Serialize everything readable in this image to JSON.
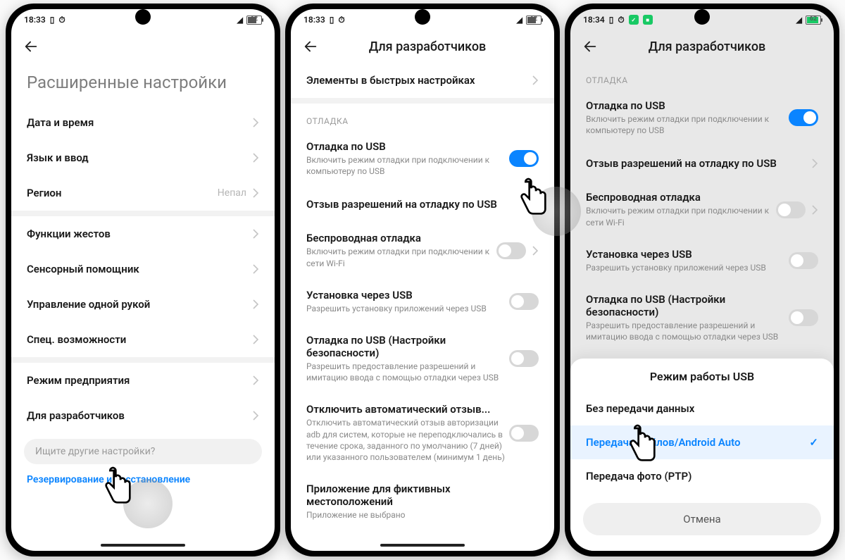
{
  "phone1": {
    "status": {
      "time": "18:33",
      "icons": [
        "vibrate",
        "alarm"
      ],
      "battery": "62"
    },
    "title": "Расширенные настройки",
    "items": [
      {
        "label": "Дата и время"
      },
      {
        "label": "Язык и ввод"
      },
      {
        "label": "Регион",
        "value": "Непал"
      }
    ],
    "items2": [
      {
        "label": "Функции жестов"
      },
      {
        "label": "Сенсорный помощник"
      },
      {
        "label": "Управление одной рукой"
      },
      {
        "label": "Спец. возможности"
      }
    ],
    "items3": [
      {
        "label": "Режим предприятия"
      },
      {
        "label": "Для разработчиков"
      }
    ],
    "search_placeholder": "Ищите другие настройки?",
    "bluelink": "Резервирование и восстановление"
  },
  "phone2": {
    "status": {
      "time": "18:33",
      "battery": "62"
    },
    "title": "Для разработчиков",
    "top_item": {
      "label": "Элементы в быстрых настройках"
    },
    "section": "ОТЛАДКА",
    "items": [
      {
        "label": "Отладка по USB",
        "sub": "Включить режим отладки при подключении к компьютеру по USB",
        "toggle": true
      },
      {
        "label": "Отзыв разрешений на отладку по USB"
      },
      {
        "label": "Беспроводная отладка",
        "sub": "Включить режим отладки при подключении к сети Wi-Fi",
        "toggle": false,
        "chev": true
      },
      {
        "label": "Установка через USB",
        "sub": "Разрешить установку приложений через USB",
        "toggle": false
      },
      {
        "label": "Отладка по USB (Настройки безопасности)",
        "sub": "Разрешить предоставление разрешений и имитацию ввода с помощью отладки через USB",
        "toggle": false
      },
      {
        "label": "Отключить автоматический отзыв...",
        "sub": "Отключить автоматический отзыв авторизации adb для систем, которые не переподключались в течение срока, заданного по умолчанию (7 дней) или указанного пользователем (минимум 1 день)",
        "toggle": false
      },
      {
        "label": "Приложение для фиктивных местоположений",
        "sub": "Приложение не выбрано"
      }
    ]
  },
  "phone3": {
    "status": {
      "time": "18:34",
      "battery": "62"
    },
    "title": "Для разработчиков",
    "section": "ОТЛАДКА",
    "items": [
      {
        "label": "Отладка по USB",
        "sub": "Включить режим отладки при подключении к компьютеру по USB",
        "toggle": true
      },
      {
        "label": "Отзыв разрешений на отладку по USB",
        "chev": true
      },
      {
        "label": "Беспроводная отладка",
        "sub": "Включить режим отладки при подключении к сети Wi-Fi",
        "toggle": false,
        "chev": true
      },
      {
        "label": "Установка через USB",
        "sub": "Разрешить установку приложений через USB",
        "toggle": false
      },
      {
        "label": "Отладка по USB (Настройки безопасности)",
        "sub": "Разрешить предоставление разрешений и имитацию ввода с помощью отладки через USB",
        "toggle": false
      }
    ],
    "sheet": {
      "title": "Режим работы USB",
      "options": [
        {
          "label": "Без передачи данных",
          "selected": false
        },
        {
          "label": "Передача файлов/Android Auto",
          "selected": true
        },
        {
          "label": "Передача фото (PTP)",
          "selected": false
        }
      ],
      "cancel": "Отмена"
    }
  }
}
